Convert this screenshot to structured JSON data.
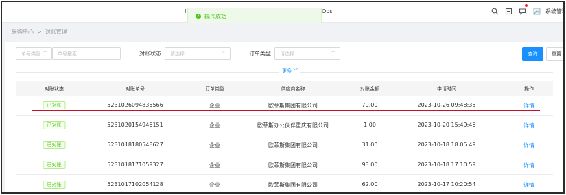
{
  "topbar": {
    "app_title_left": "I",
    "app_title_right": "Ops",
    "icons": [
      "search-icon",
      "fullscreen-icon",
      "message-icon",
      "avatar"
    ],
    "user_name": "系统管理员"
  },
  "toast": {
    "message": "操作成功",
    "color": "#52c41a"
  },
  "breadcrumb": {
    "items": [
      "采购中心",
      "对账管理"
    ],
    "separator": ">"
  },
  "filters": {
    "order_no_type": {
      "placeholder": "单号类型"
    },
    "order_no_search": {
      "placeholder": "单号搜索"
    },
    "status_label": "对账状态",
    "status_select": {
      "placeholder": "请选择"
    },
    "order_type_label": "订单类型",
    "order_type_select": {
      "placeholder": "请选择"
    },
    "query_label": "查询",
    "reset_label": "重置",
    "more_label": "更多 ﹀"
  },
  "table": {
    "columns": [
      "对账状态",
      "对账单号",
      "订单类型",
      "供应商名称",
      "对账金额",
      "申请时间",
      "操作"
    ],
    "rows": [
      {
        "status": "已对账",
        "no": "5231026094835566",
        "type": "企业",
        "supplier": "欧菲斯集团有限公司",
        "amount": "79.00",
        "time": "2023-10-26 09:48:35",
        "action": "详情"
      },
      {
        "status": "已对账",
        "no": "5231020154946151",
        "type": "企业",
        "supplier": "欧菲斯办公伙伴重庆有限公司",
        "amount": "1.00",
        "time": "2023-10-20 15:49:46",
        "action": "详情"
      },
      {
        "status": "已对账",
        "no": "5231018180548627",
        "type": "企业",
        "supplier": "欧菲斯集团有限公司",
        "amount": "31.00",
        "time": "2023-10-18 18:05:49",
        "action": "详情"
      },
      {
        "status": "已对账",
        "no": "5231018171059327",
        "type": "企业",
        "supplier": "欧菲斯集团有限公司",
        "amount": "93.00",
        "time": "2023-10-18 17:10:59",
        "action": "详情"
      },
      {
        "status": "已对账",
        "no": "5231017102054128",
        "type": "企业",
        "supplier": "欧菲斯集团有限公司",
        "amount": "62.00",
        "time": "2023-10-17 10:20:54",
        "action": "详情"
      }
    ]
  },
  "colors": {
    "accent": "#1890ff",
    "success": "#52c41a",
    "annotation": "#c8102e"
  }
}
